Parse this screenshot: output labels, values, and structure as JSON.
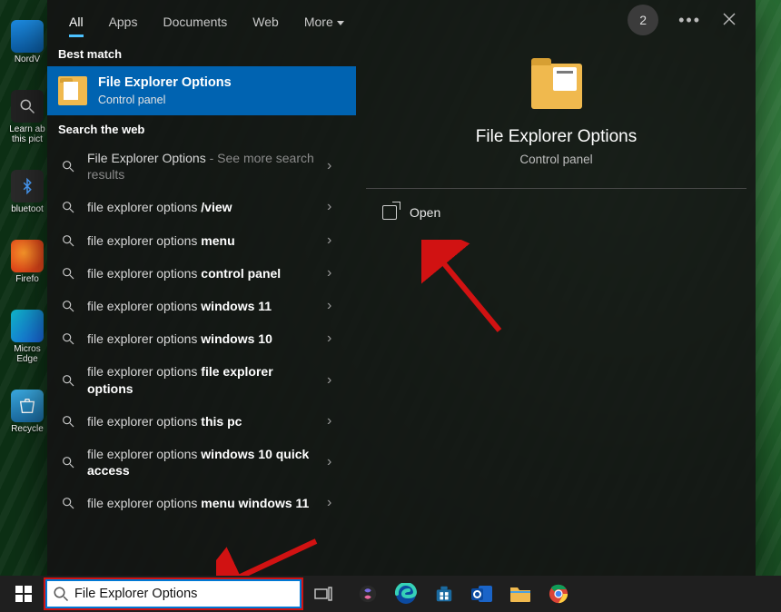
{
  "desktop": {
    "icons": [
      {
        "label": "NordV",
        "key": "nordvpn-icon"
      },
      {
        "label": "Learn ab\nthis pict",
        "key": "learn-about-icon"
      },
      {
        "label": "bluetoot",
        "key": "bluetooth-icon"
      },
      {
        "label": "Firefo",
        "key": "firefox-icon"
      },
      {
        "label": "Micros\nEdge",
        "key": "edge-icon"
      },
      {
        "label": "Recycle",
        "key": "recycle-bin-icon"
      }
    ]
  },
  "tabs": {
    "all": "All",
    "apps": "Apps",
    "documents": "Documents",
    "web": "Web",
    "more": "More",
    "badge": "2"
  },
  "left": {
    "best_match_label": "Best match",
    "best": {
      "title": "File Explorer Options",
      "subtitle": "Control panel"
    },
    "web_label": "Search the web",
    "suggestions": [
      {
        "prefix": "",
        "main": "File Explorer Options",
        "bold": "",
        "suffix_gray": " - See more search results"
      },
      {
        "prefix": "file explorer options ",
        "bold": "/view",
        "suffix_gray": ""
      },
      {
        "prefix": "file explorer options ",
        "bold": "menu",
        "suffix_gray": ""
      },
      {
        "prefix": "file explorer options ",
        "bold": "control panel",
        "suffix_gray": ""
      },
      {
        "prefix": "file explorer options ",
        "bold": "windows 11",
        "suffix_gray": ""
      },
      {
        "prefix": "file explorer options ",
        "bold": "windows 10",
        "suffix_gray": ""
      },
      {
        "prefix": "file explorer options ",
        "bold": "file explorer options",
        "suffix_gray": ""
      },
      {
        "prefix": "file explorer options ",
        "bold": "this pc",
        "suffix_gray": ""
      },
      {
        "prefix": "file explorer options ",
        "bold": "windows 10 quick access",
        "suffix_gray": ""
      },
      {
        "prefix": "file explorer options ",
        "bold": "menu windows 11",
        "suffix_gray": ""
      }
    ]
  },
  "right": {
    "title": "File Explorer Options",
    "subtitle": "Control panel",
    "open_label": "Open"
  },
  "taskbar": {
    "search_value": "File Explorer Options"
  }
}
